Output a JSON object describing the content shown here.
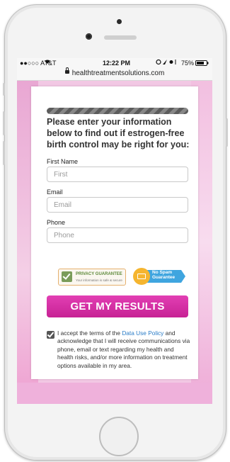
{
  "status_bar": {
    "carrier": "●●○○○ AT&T",
    "time": "12:22 PM",
    "battery": "75%"
  },
  "browser": {
    "url": "healthtreatmentsolutions.com"
  },
  "form": {
    "headline": "Please enter your information below to find out if estrogen-free birth control may be right for you:",
    "first_name": {
      "label": "First Name",
      "placeholder": "First"
    },
    "email": {
      "label": "Email",
      "placeholder": "Email"
    },
    "phone": {
      "label": "Phone",
      "placeholder": "Phone"
    },
    "badges": {
      "privacy_title": "PRIVACY GUARANTEE",
      "privacy_sub": "Your information is safe & secure",
      "no_spam": "No Spam Guarantee"
    },
    "submit_label": "GET MY RESULTS",
    "consent": {
      "prefix": "I accept the terms of the ",
      "link": "Data Use Policy",
      "suffix": " and acknowledge that I will receive communications via phone, email or text regarding my health and health risks, and/or more information on treatment options available in my area.",
      "checked": true
    }
  },
  "colors": {
    "accent": "#d12fa4",
    "link": "#2a7cc7"
  }
}
